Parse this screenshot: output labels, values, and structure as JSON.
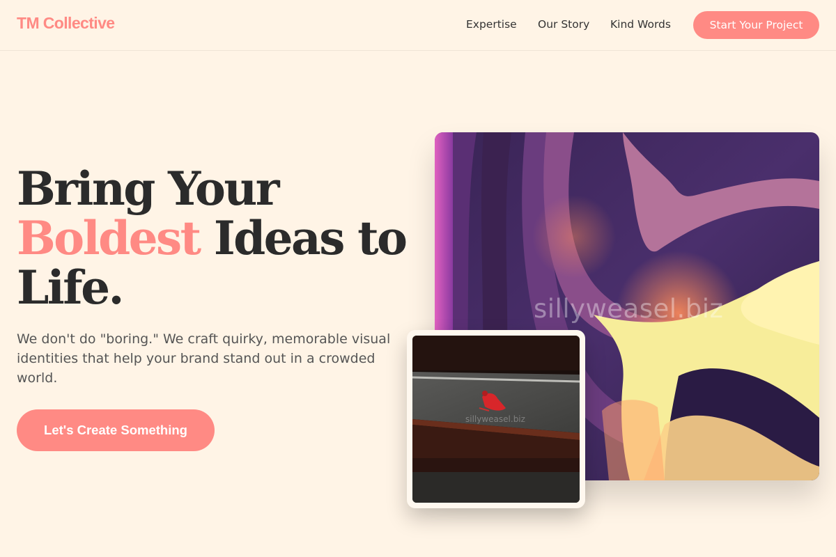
{
  "header": {
    "logo": "TM Collective",
    "nav": [
      {
        "label": "Expertise"
      },
      {
        "label": "Our Story"
      },
      {
        "label": "Kind Words"
      }
    ],
    "cta_label": "Start Your Project"
  },
  "hero": {
    "title_line1": "Bring Your",
    "title_accent": "Boldest",
    "title_line2_rest": " Ideas to",
    "title_line3": "Life.",
    "subtitle": "We don't do \"boring.\" We craft quirky, memorable visual identities that help your brand stand out in a crowded world.",
    "cta_label": "Let's Create Something"
  },
  "artwork": {
    "main_watermark": "sillyweasel.biz",
    "photo_watermark": "sillyweasel.biz"
  },
  "colors": {
    "background": "#fff4e6",
    "accent": "#ff8a84",
    "text": "#2b2b2b",
    "muted_text": "#555555"
  }
}
